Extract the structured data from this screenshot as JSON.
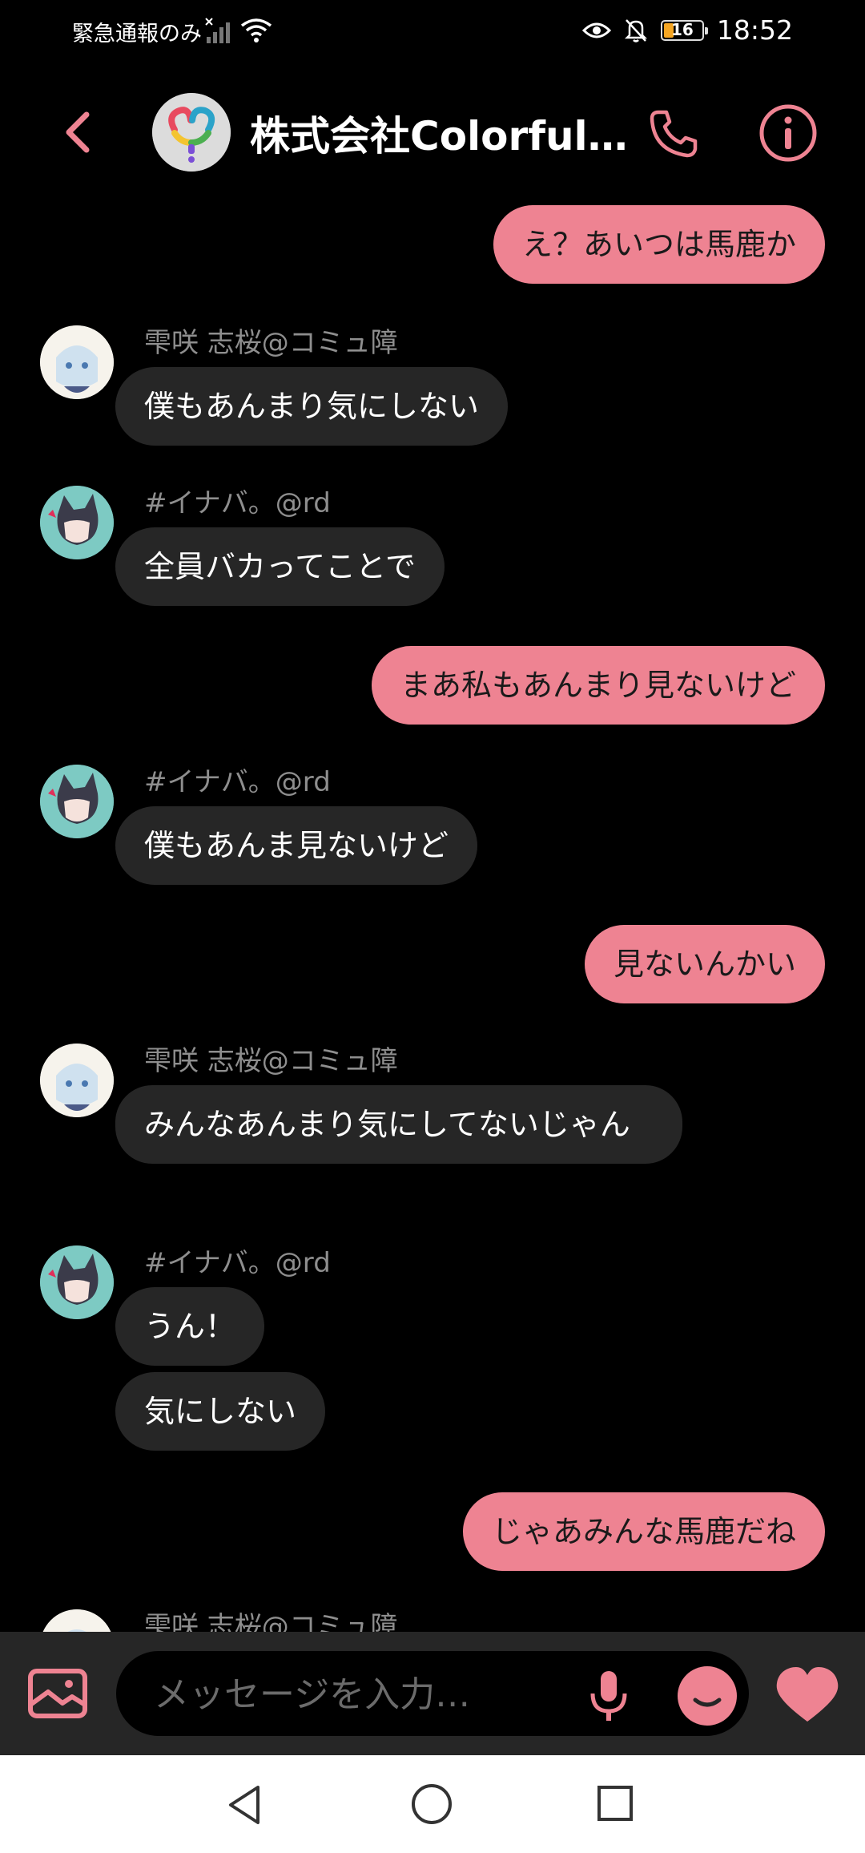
{
  "status_bar": {
    "carrier_text": "緊急通報のみ",
    "battery_level": "16",
    "time": "18:52",
    "icons": [
      "no-signal-icon",
      "wifi-icon",
      "eye-comfort-icon",
      "bell-muted-icon",
      "battery-icon"
    ]
  },
  "header": {
    "title": "株式会社Colorful…",
    "icons": [
      "back-arrow-icon",
      "phone-icon",
      "info-icon"
    ]
  },
  "messages": [
    {
      "from": "me",
      "text": "え？あいつは馬鹿か"
    },
    {
      "from": "other",
      "sender": "雫咲 志桜@コミュ障",
      "text": "僕もあんまり気にしない"
    },
    {
      "from": "other",
      "sender": "#イナバ。@rd",
      "text": "全員バカってことで"
    },
    {
      "from": "me",
      "text": "まあ私もあんまり見ないけど"
    },
    {
      "from": "other",
      "sender": "#イナバ。@rd",
      "text": "僕もあんま見ないけど"
    },
    {
      "from": "me",
      "text": "見ないんかい"
    },
    {
      "from": "other",
      "sender": "雫咲 志桜@コミュ障",
      "text": "みんなあんまり気にしてないじゃん"
    },
    {
      "from": "other",
      "sender": "#イナバ。@rd",
      "text": "うん！"
    },
    {
      "from": "other",
      "sender": "",
      "text": "気にしない"
    },
    {
      "from": "me",
      "text": "じゃあみんな馬鹿だね"
    },
    {
      "from": "other",
      "sender": "雫咲 志桜@コミュ障",
      "text": ""
    }
  ],
  "composer": {
    "placeholder": "メッセージを入力…",
    "icons": [
      "gallery-icon",
      "microphone-icon",
      "emoji-icon",
      "heart-icon"
    ]
  },
  "colors": {
    "accent": "#ee8392",
    "background": "#000000",
    "other_bubble": "#262626",
    "composer_bar": "#262626",
    "sender_name": "#8e8e8e"
  }
}
